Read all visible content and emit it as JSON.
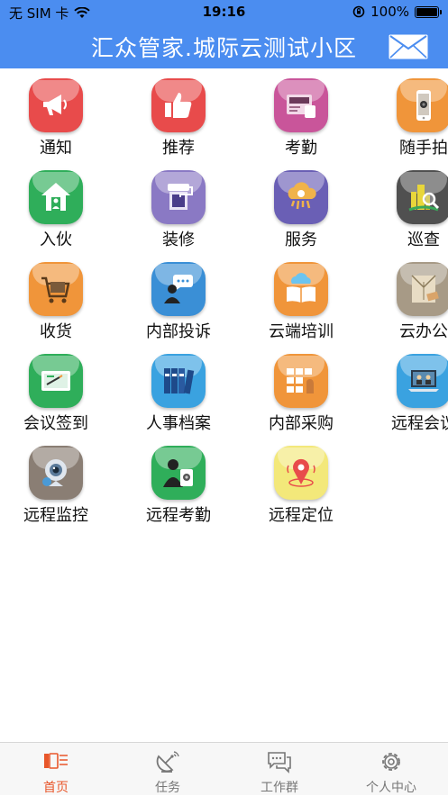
{
  "status_bar": {
    "carrier": "无 SIM 卡",
    "time": "19:16",
    "battery": "100%"
  },
  "header": {
    "title": "汇众管家.城际云测试小区",
    "mail_icon": "mail-icon"
  },
  "grid": [
    {
      "label": "通知",
      "icon": "megaphone-icon",
      "color": "#e84b4b"
    },
    {
      "label": "推荐",
      "icon": "thumbs-up-icon",
      "color": "#e84b4b"
    },
    {
      "label": "考勤",
      "icon": "card-reader-icon",
      "color": "#c9559a"
    },
    {
      "label": "随手拍",
      "icon": "phone-camera-icon",
      "color": "#f0953a"
    },
    {
      "label": "入伙",
      "icon": "house-icon",
      "color": "#2fae5a"
    },
    {
      "label": "装修",
      "icon": "paint-roller-icon",
      "color": "#8a79c4"
    },
    {
      "label": "服务",
      "icon": "cloud-service-icon",
      "color": "#6a5fb5"
    },
    {
      "label": "巡查",
      "icon": "magnifier-icon",
      "color": "#505050"
    },
    {
      "label": "收货",
      "icon": "shopping-cart-icon",
      "color": "#f0953a"
    },
    {
      "label": "内部投诉",
      "icon": "complaint-icon",
      "color": "#3a8fd6"
    },
    {
      "label": "云端培训",
      "icon": "cloud-book-icon",
      "color": "#f0953a"
    },
    {
      "label": "云办公",
      "icon": "envelope-icon",
      "color": "#a79a86"
    },
    {
      "label": "会议签到",
      "icon": "sign-in-icon",
      "color": "#2fae5a"
    },
    {
      "label": "人事档案",
      "icon": "binders-icon",
      "color": "#3aa2e0"
    },
    {
      "label": "内部采购",
      "icon": "purchase-icon",
      "color": "#f0953a"
    },
    {
      "label": "远程会议",
      "icon": "laptop-meeting-icon",
      "color": "#3aa2e0"
    },
    {
      "label": "远程监控",
      "icon": "webcam-icon",
      "color": "#8a7e74"
    },
    {
      "label": "远程考勤",
      "icon": "remote-attendance-icon",
      "color": "#2fae5a"
    },
    {
      "label": "远程定位",
      "icon": "location-pin-icon",
      "color": "#f3e87a"
    }
  ],
  "tabbar": [
    {
      "label": "首页",
      "icon": "home-icon",
      "active": true
    },
    {
      "label": "任务",
      "icon": "satellite-dish-icon",
      "active": false
    },
    {
      "label": "工作群",
      "icon": "chat-bubbles-icon",
      "active": false
    },
    {
      "label": "个人中心",
      "icon": "gear-icon",
      "active": false
    }
  ],
  "colors": {
    "header_bg": "#4b8df0",
    "tab_active": "#e8562a",
    "tab_inactive": "#777777"
  }
}
